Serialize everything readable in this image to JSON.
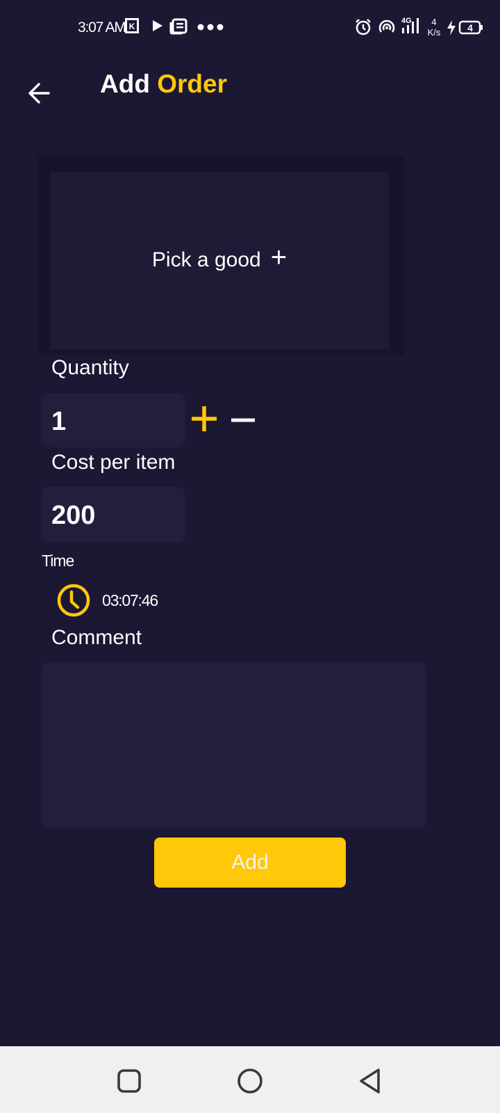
{
  "status_bar": {
    "time": "3:07 AM",
    "net_speed_value": "4",
    "net_speed_unit": "K/s",
    "network_type": "4G",
    "battery_level": "4"
  },
  "header": {
    "title_part1": "Add",
    "title_part2": "Order"
  },
  "picker": {
    "label": "Pick a good",
    "plus": "+"
  },
  "quantity": {
    "label": "Quantity",
    "value": "1"
  },
  "cost": {
    "label": "Cost per item",
    "value": "200"
  },
  "time": {
    "label": "Time",
    "value": "03:07:46"
  },
  "comment": {
    "label": "Comment",
    "value": "",
    "placeholder": ""
  },
  "add_button": {
    "label": "Add"
  },
  "colors": {
    "background": "#1c1733",
    "accent": "#ffc808",
    "field": "#221e3b",
    "nav_bar": "#f0f0f0"
  },
  "icons": [
    "back-arrow-icon",
    "plus-icon",
    "minus-icon",
    "clock-icon",
    "alarm-icon",
    "hotspot-icon",
    "signal-icon",
    "battery-icon",
    "charging-icon",
    "recents-icon",
    "home-icon",
    "back-nav-icon",
    "play-icon",
    "news-icon",
    "k-app-icon",
    "more-dots-icon"
  ]
}
